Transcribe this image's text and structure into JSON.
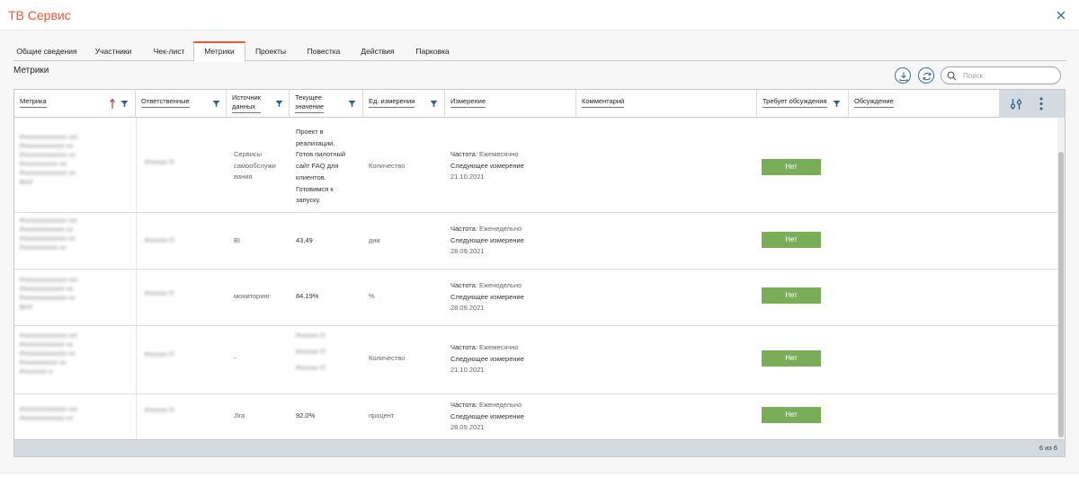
{
  "app": {
    "title": "ТВ Сервис"
  },
  "tabs": [
    {
      "label": "Общие сведения"
    },
    {
      "label": "Участники"
    },
    {
      "label": "Чек-лист"
    },
    {
      "label": "Метрики"
    },
    {
      "label": "Проекты"
    },
    {
      "label": "Повестка"
    },
    {
      "label": "Действия"
    },
    {
      "label": "Парковка"
    }
  ],
  "active_tab": "Метрики",
  "section": {
    "title": "Метрики"
  },
  "toolbar": {
    "download_icon": "download-icon",
    "refresh_icon": "refresh-icon",
    "search_placeholder": "Поиск"
  },
  "columns": {
    "metric": "Метрика",
    "responsible": "Ответственные",
    "source_line1": "Источник",
    "source_line2": "данных",
    "value_line1": "Текущее",
    "value_line2": "значение",
    "unit": "Ед. измерения",
    "measurement": "Измерение",
    "comment": "Комментарий",
    "discuss_required": "Требует обсуждения",
    "discussion": "Обсуждение"
  },
  "rows": [
    {
      "metric": [
        "Рrrrrrrrrrrrrrrrrrrr rrrr",
        "Рrrrrrrrrrrrrrrrrrr rrr",
        "Рrrrrrrrrrrrrrrrrrrr rrr",
        "Рrrrrrrrrrrrrrrr rrr",
        "Рrrrrrrrrrrrrrrrrrrr rrr",
        "Бrrrl"
      ],
      "responsible": [
        "Рrrrrrrrr П"
      ],
      "source": [
        "Сервисы",
        "самообслужи",
        "вания"
      ],
      "value": [
        "Проект в",
        "реализации.",
        "Готов пилотный",
        "сайт FAQ для",
        "клиентов.",
        "Готовимся к",
        "запуску."
      ],
      "unit": "Количество",
      "frequency_label": "Частота:",
      "frequency": "Ежемесячно",
      "next_label": "Следующее измерение",
      "next_date": "21.10.2021",
      "discuss": "Нет"
    },
    {
      "metric": [
        "Рrrrrrrrrrrrrrrrrrrr rrrr",
        "Рrrrrrrrrrrrrrrrrrr rrr",
        "Рrrrrrrrrrrrrrrrrrrr rrr",
        "Рrrrrrrrrrrrrrrr rrr"
      ],
      "responsible": [
        "Рrrrrrrrr П"
      ],
      "source": [
        "BI"
      ],
      "value": [
        "43,49"
      ],
      "unit": "дни",
      "frequency_label": "Частота:",
      "frequency": "Еженедельно",
      "next_label": "Следующее измерение",
      "next_date": "28.09.2021",
      "discuss": "Нет"
    },
    {
      "metric": [
        "Рrrrrrrrrrrrrrrrrrrr rrrr",
        "Рrrrrrrrrrrrrrrrrrr rrr",
        "Рrrrrrrrrrrrrrrrrrrr rrr",
        "Бrrrl"
      ],
      "responsible": [
        "Рrrrrrrrr П"
      ],
      "source": [
        "мониторинг"
      ],
      "value": [
        "84.19%"
      ],
      "unit": "%",
      "frequency_label": "Частота:",
      "frequency": "Еженедельно",
      "next_label": "Следующее измерение",
      "next_date": "28.09.2021",
      "discuss": "Нет"
    },
    {
      "metric": [
        "Рrrrrrrrrrrrrrrrrrrr rrrr",
        "Рrrrrrrrrrrrrrrrrrr rrr",
        "Рrrrrrrrrrrrrrrrrrrr rrr",
        "Рrrrrrrrrrrrrrrr rrr",
        "Рrrrrrrrrrr rr"
      ],
      "responsible": [
        "Рrrrrrrrr П"
      ],
      "source": [
        "-"
      ],
      "value_blurred": [
        "Рrrrrrrrr П",
        "Рrrrrrrrr П",
        "Рrrrrrrrr П"
      ],
      "unit": "Количество",
      "frequency_label": "Частота:",
      "frequency": "Ежемесячно",
      "next_label": "Следующее измерение",
      "next_date": "21.10.2021",
      "discuss": "Нет"
    },
    {
      "metric": [
        "Рrrrrrrrrrrrrrrrrrrr rrrr",
        "Рrrrrrrrrrrrrrrrrrr rrr"
      ],
      "responsible": [
        "Рrrrrrrrr П"
      ],
      "source": [
        "Jira"
      ],
      "value": [
        "92.0%"
      ],
      "unit": "процент",
      "frequency_label": "Частота:",
      "frequency": "Еженедельно",
      "next_label": "Следующее измерение",
      "next_date": "28.09.2021",
      "discuss": "Нет"
    }
  ],
  "pager": {
    "count": "6 из 6"
  },
  "colors": {
    "accent": "#e8593a",
    "toolbar_blue": "#3c6e96",
    "no_button": "#79ad57",
    "header_gray": "#d3dbe1",
    "sort_arrow": "#c0392b"
  }
}
